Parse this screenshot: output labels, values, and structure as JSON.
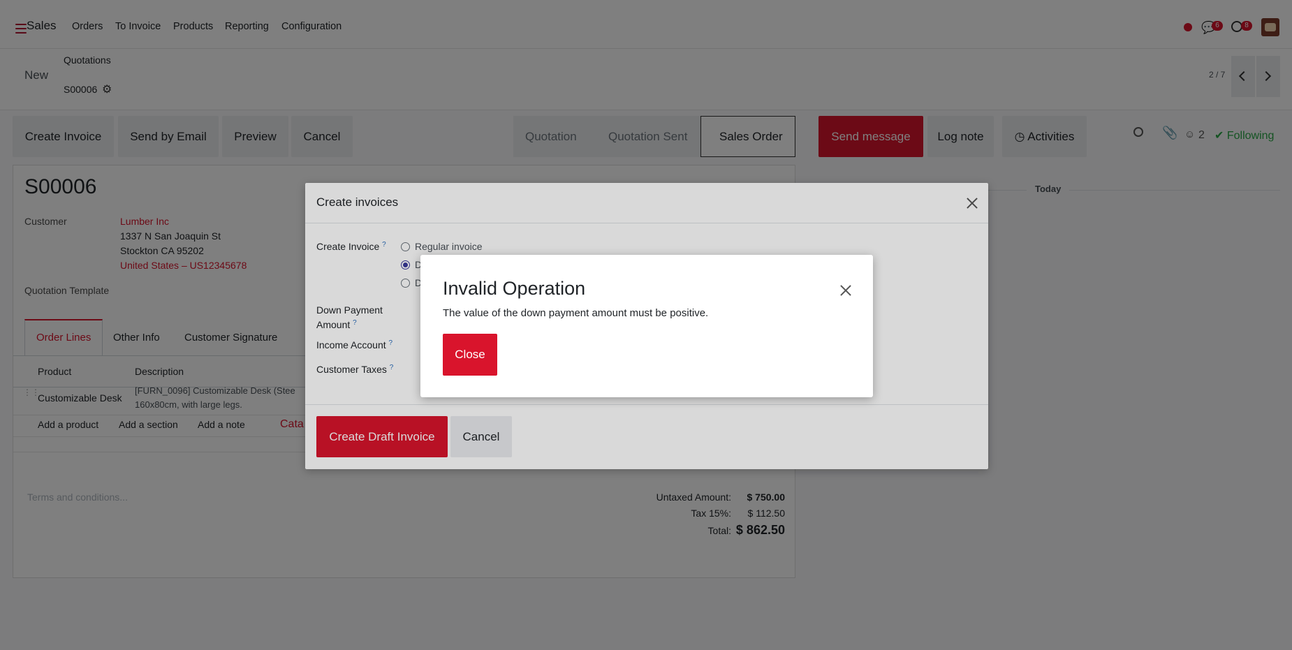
{
  "colors": {
    "brand": "#d9142c",
    "success": "#28a745"
  },
  "nav": {
    "app": "Sales",
    "items": [
      "Orders",
      "To Invoice",
      "Products",
      "Reporting",
      "Configuration"
    ],
    "messages_count": "6",
    "activities_count": "8"
  },
  "control": {
    "new_label": "New",
    "breadcrumb": "Quotations",
    "record": "S00006",
    "pager": "2 / 7"
  },
  "actions": {
    "create_invoice": "Create Invoice",
    "send_email": "Send by Email",
    "preview": "Preview",
    "cancel": "Cancel"
  },
  "stages": [
    "Quotation",
    "Quotation Sent",
    "Sales Order"
  ],
  "chatter": {
    "send_message": "Send message",
    "log_note": "Log note",
    "activities": "Activities",
    "followers": "2",
    "following": "Following",
    "today": "Today"
  },
  "form": {
    "title": "S00006",
    "customer_label": "Customer",
    "customer_name": "Lumber Inc",
    "address1": "1337 N San Joaquin St",
    "address2": "Stockton CA 95202",
    "address3": "United States – US12345678",
    "template_label": "Quotation Template",
    "tabs": [
      "Order Lines",
      "Other Info",
      "Customer Signature"
    ],
    "col_product": "Product",
    "col_description": "Description",
    "row_product": "Customizable Desk",
    "row_desc1": "[FURN_0096] Customizable Desk (Stee",
    "row_desc2": "160x80cm, with large legs.",
    "add_product": "Add a product",
    "add_section": "Add a section",
    "add_note": "Add a note",
    "catalog": "Cata",
    "terms_placeholder": "Terms and conditions...",
    "untaxed_label": "Untaxed Amount:",
    "untaxed_value": "$ 750.00",
    "tax_label": "Tax 15%:",
    "tax_value": "$ 112.50",
    "total_label": "Total:",
    "total_value": "$ 862.50"
  },
  "dialog": {
    "title": "Create invoices",
    "create_invoice_label": "Create Invoice",
    "option_regular": "Regular invoice",
    "option_2_partial": "D",
    "option_3_partial": "D",
    "selected_option": "D",
    "down_payment_label1": "Down Payment",
    "down_payment_label2": "Amount",
    "income_account_label": "Income Account",
    "customer_taxes_label": "Customer Taxes",
    "help_mark": "?",
    "create_draft": "Create Draft Invoice",
    "cancel": "Cancel"
  },
  "error": {
    "title": "Invalid Operation",
    "message": "The value of the down payment amount must be positive.",
    "close": "Close"
  }
}
